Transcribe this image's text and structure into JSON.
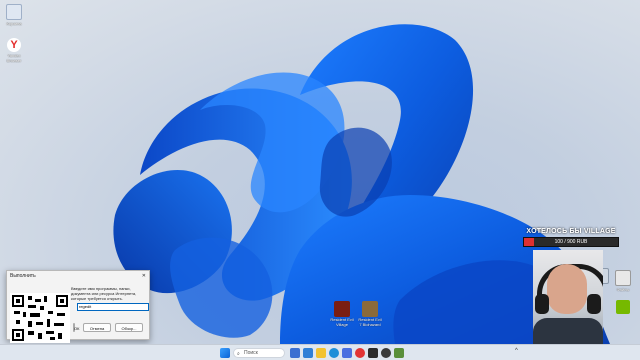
{
  "desktop_icons": [
    {
      "label": "Корзина",
      "icon": "recycle-bin-icon",
      "color": "#dfe7f2"
    },
    {
      "label": "Yandex Browser",
      "icon": "yandex-browser-icon",
      "color": "#e32b2b"
    }
  ],
  "right_desktop_icons": [
    {
      "label": "Этот компьютер",
      "icon": "computer-icon",
      "color": "#cfd8e3"
    },
    {
      "label": "Файлы",
      "icon": "file-icon",
      "color": "#e8e8e8"
    },
    {
      "label": "NVIDIA",
      "icon": "nvidia-icon",
      "color": "#76b900"
    }
  ],
  "game_icons": [
    {
      "label": "Resident Evil Village",
      "icon": "re-village-icon",
      "color": "#7a1e12"
    },
    {
      "label": "Resident Evil 7 Biohazard",
      "icon": "re7-icon",
      "color": "#8a6a3a"
    }
  ],
  "donation": {
    "title": "ХОТЕЛОСЬ БЫ VILLAGE",
    "progress_text": "100 / 900 RUB",
    "progress_fraction": 0.111,
    "bar_color": "#e03030"
  },
  "run_dialog": {
    "title": "Выполнить",
    "close": "✕",
    "description": "Введите имя программы, папки, документа или ресурса Интернета, которые требуется открыть.",
    "open_label": "Открыть:",
    "input_value": "regedit",
    "ok": "ОК",
    "cancel": "Отмена",
    "browse": "Обзор..."
  },
  "taskbar": {
    "search_placeholder": "Поиск",
    "search_icon": "search-icon",
    "start_icon": "windows-start-icon",
    "apps": [
      {
        "name": "task-view-icon",
        "color": "#3b6fd1"
      },
      {
        "name": "widgets-icon",
        "color": "#2f7fd6"
      },
      {
        "name": "file-explorer-icon",
        "color": "#f2c230"
      },
      {
        "name": "edge-icon",
        "color": "#1e8fd8"
      },
      {
        "name": "store-icon",
        "color": "#4a6fe0"
      },
      {
        "name": "yandex-icon",
        "color": "#e23434"
      },
      {
        "name": "terminal-icon",
        "color": "#2b2b2b"
      },
      {
        "name": "obs-icon",
        "color": "#3a3a3a"
      },
      {
        "name": "app-icon",
        "color": "#5a8f3a"
      }
    ],
    "tray_chevron": "^"
  }
}
